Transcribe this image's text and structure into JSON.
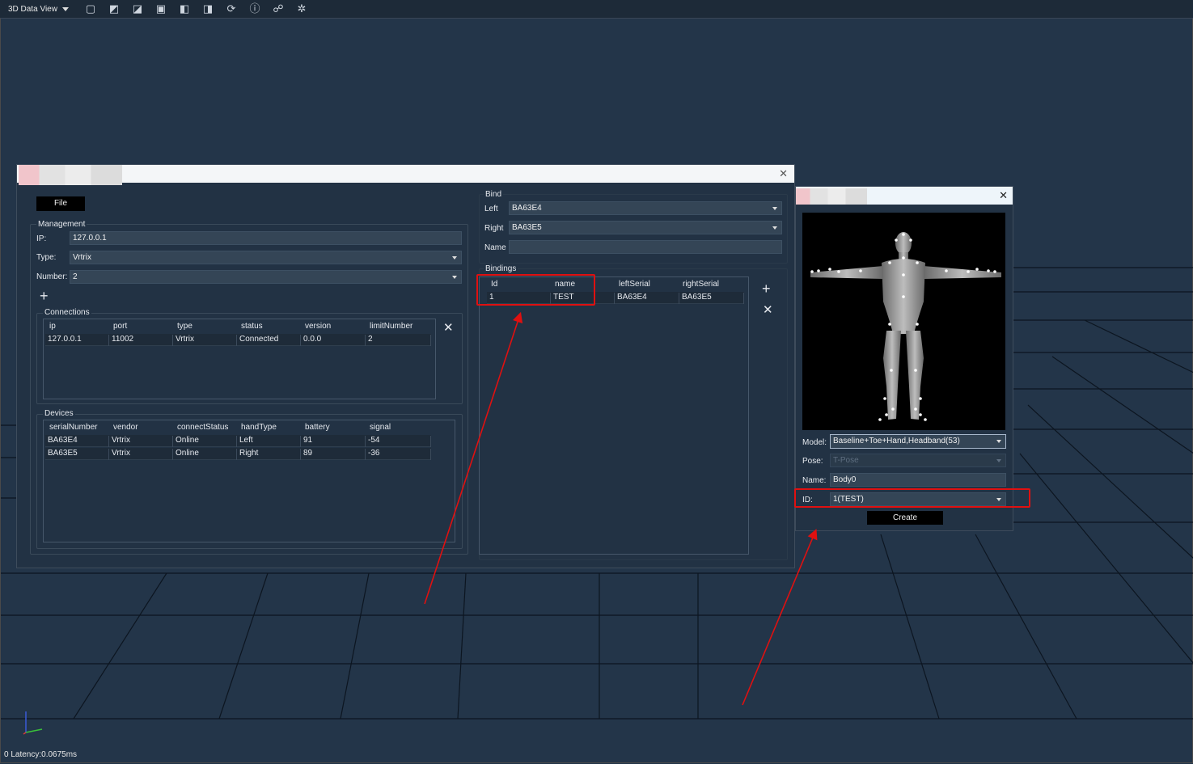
{
  "toolbar": {
    "title": "3D Data View",
    "icons": [
      "cube-front-icon",
      "cube-left-icon",
      "cube-right-icon",
      "cube-top-icon",
      "cube-back-icon",
      "cube-bottom-icon",
      "refresh-icon",
      "person-icon",
      "skeleton-icon",
      "sparkle-icon"
    ]
  },
  "status": {
    "latency": "0 Latency:0.0675ms"
  },
  "axes": {
    "y": "Y",
    "x": "X",
    "z": "Z"
  },
  "main_window": {
    "file_button": "File",
    "management": {
      "label": "Management",
      "ip_label": "IP:",
      "ip_value": "127.0.0.1",
      "type_label": "Type:",
      "type_value": "Vrtrix",
      "number_label": "Number:",
      "number_value": "2"
    },
    "connections": {
      "label": "Connections",
      "columns": [
        "ip",
        "port",
        "type",
        "status",
        "version",
        "limitNumber"
      ],
      "rows": [
        [
          "127.0.0.1",
          "11002",
          "Vrtrix",
          "Connected",
          "0.0.0",
          "2"
        ]
      ]
    },
    "devices": {
      "label": "Devices",
      "columns": [
        "serialNumber",
        "vendor",
        "connectStatus",
        "handType",
        "battery",
        "signal"
      ],
      "rows": [
        [
          "BA63E4",
          "Vrtrix",
          "Online",
          "Left",
          "91",
          "-54"
        ],
        [
          "BA63E5",
          "Vrtrix",
          "Online",
          "Right",
          "89",
          "-36"
        ]
      ]
    },
    "bind": {
      "label": "Bind",
      "left_label": "Left",
      "left_value": "BA63E4",
      "right_label": "Right",
      "right_value": "BA63E5",
      "name_label": "Name",
      "name_value": ""
    },
    "bindings": {
      "label": "Bindings",
      "columns": [
        "Id",
        "name",
        "leftSerial",
        "rightSerial"
      ],
      "rows": [
        [
          "1",
          "TEST",
          "BA63E4",
          "BA63E5"
        ]
      ]
    }
  },
  "create_window": {
    "model_label": "Model:",
    "model_value": "Baseline+Toe+Hand,Headband(53)",
    "pose_label": "Pose:",
    "pose_value": "T-Pose",
    "name_label": "Name:",
    "name_value": "Body0",
    "id_label": "ID:",
    "id_value": "1(TEST)",
    "create_button": "Create"
  },
  "colors": {
    "background": "#233549",
    "panel": "#223244",
    "field": "#344556",
    "highlight": "#e01010"
  }
}
